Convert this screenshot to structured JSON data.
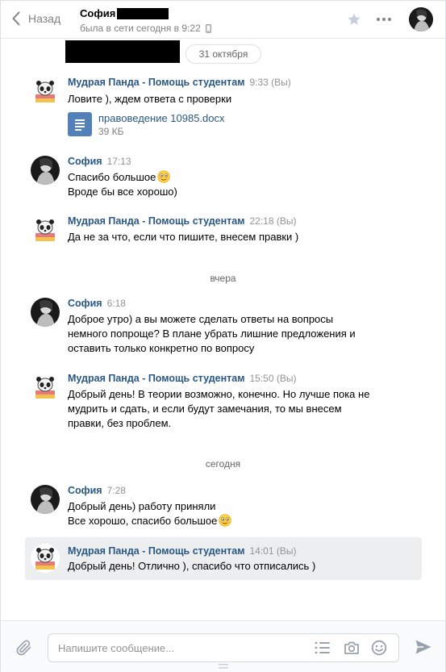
{
  "header": {
    "back_label": "Назад",
    "peer_name": "София",
    "peer_status": "была в сети сегодня в 9:22"
  },
  "history": {
    "date_top": "31 октября",
    "sep_yesterday": "вчера",
    "sep_today": "сегодня",
    "messages": [
      {
        "author": "Мудрая Панда - Помощь студентам",
        "time": "9:33 (Вы)",
        "lines": [
          "Ловите ), ждем ответа с проверки"
        ],
        "doc": {
          "name": "правоведение 10985.docx",
          "size": "39 КБ"
        }
      },
      {
        "author": "София",
        "time": "17:13",
        "lines": [
          "Спасибо большое",
          "Вроде бы все хорошо)"
        ]
      },
      {
        "author": "Мудрая Панда - Помощь студентам",
        "time": "22:18 (Вы)",
        "lines": [
          "Да не за что, если что пишите, внесем правки )"
        ]
      },
      {
        "author": "София",
        "time": "6:18",
        "lines": [
          "Доброе утро) а вы можете сделать ответы на вопросы",
          "немного попроще? В плане убрать лишние предложения и",
          "оставить только конкретно по вопросу"
        ]
      },
      {
        "author": "Мудрая Панда - Помощь студентам",
        "time": "15:50 (Вы)",
        "lines": [
          "Добрый день! В теории возможно, конечно. Но лучше пока не",
          "мудрить и сдать, и если будут замечания, то мы внесем",
          "правки, без проблем."
        ]
      },
      {
        "author": "София",
        "time": "7:28",
        "lines": [
          "Добрый день) работу приняли",
          "Все хорошо, спасибо большое"
        ]
      },
      {
        "author": "Мудрая Панда - Помощь студентам",
        "time": "14:01 (Вы)",
        "lines": [
          "Добрый день! Отлично ), спасибо что отписались )"
        ]
      }
    ]
  },
  "composer": {
    "placeholder": "Напишите сообщение..."
  },
  "colors": {
    "link": "#2a5885",
    "accent": "#5181b8",
    "muted": "#828282",
    "selected_bg": "#edeef0"
  }
}
